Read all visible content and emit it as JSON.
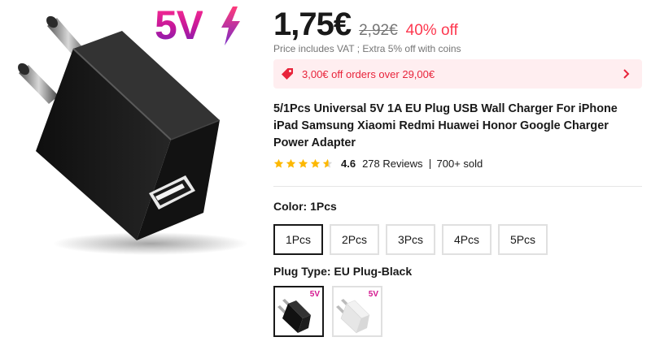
{
  "product_image": {
    "badge_text": "5V",
    "bolt_icon": "lightning-bolt-icon"
  },
  "price": {
    "current": "1,75€",
    "original": "2,92€",
    "discount": "40% off",
    "vat_note": "Price includes VAT ; Extra 5% off with coins"
  },
  "coupon": {
    "icon": "tag-icon",
    "text": "3,00€ off orders over 29,00€",
    "arrow_icon": "chevron-right-icon"
  },
  "title": "5/1Pcs Universal 5V 1A EU Plug USB Wall Charger For iPhone iPad Samsung Xiaomi Redmi Huawei Honor Google Charger Power Adapter",
  "rating": {
    "value": "4.6",
    "stars": 4.6,
    "reviews": "278 Reviews",
    "sold": "700+ sold"
  },
  "color_option": {
    "label": "Color: ",
    "selected": "1Pcs",
    "choices": [
      "1Pcs",
      "2Pcs",
      "3Pcs",
      "4Pcs",
      "5Pcs"
    ]
  },
  "plug_option": {
    "label": "Plug Type: ",
    "selected": "EU Plug-Black",
    "swatches": [
      {
        "name": "EU Plug-Black",
        "badge": "5V"
      },
      {
        "name": "EU Plug-White",
        "badge": "5V"
      }
    ]
  },
  "colors": {
    "price_red": "#fd384f",
    "coupon_bg": "#ffeef0",
    "coupon_text": "#e8243b",
    "star": "#fdb800",
    "brand_pink": "#ff2d8e"
  }
}
